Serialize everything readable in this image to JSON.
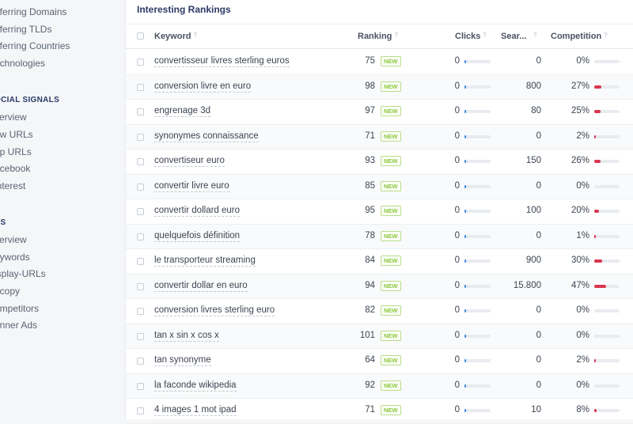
{
  "colors": {
    "clicks_bar": "#3b8be0",
    "competition_bar": "#d9364f",
    "new_badge": "#8cc63f",
    "heading": "#2b3a67"
  },
  "sidebar": {
    "items_top": [
      "eferring Domains",
      "eferring TLDs",
      "eferring Countries",
      "echnologies"
    ],
    "section_social": "OCIAL SIGNALS",
    "items_social": [
      "verview",
      "ew URLs",
      "op URLs",
      "acebook",
      "interest"
    ],
    "section_ads": "DS",
    "items_ads": [
      "verview",
      "eywords",
      "isplay-URLs",
      "dcopy",
      "ompetitors",
      "anner Ads"
    ]
  },
  "panel": {
    "title": "Interesting Rankings",
    "columns": {
      "keyword": "Keyword",
      "ranking": "Ranking",
      "clicks": "Clicks",
      "search": "Sear...",
      "competition": "Competition",
      "help_mark": "?"
    },
    "badge_label": "NEW",
    "rows": [
      {
        "keyword": "convertisseur livres sterling euros",
        "ranking": "75",
        "clicks": "0",
        "clicks_fraction": 0.03,
        "search": "0",
        "competition": "0%",
        "competition_fraction": 0.0
      },
      {
        "keyword": "conversion livre en euro",
        "ranking": "98",
        "clicks": "0",
        "clicks_fraction": 0.03,
        "search": "800",
        "competition": "27%",
        "competition_fraction": 0.27
      },
      {
        "keyword": "engrenage 3d",
        "ranking": "97",
        "clicks": "0",
        "clicks_fraction": 0.03,
        "search": "80",
        "competition": "25%",
        "competition_fraction": 0.25
      },
      {
        "keyword": "synonymes connaissance",
        "ranking": "71",
        "clicks": "0",
        "clicks_fraction": 0.03,
        "search": "0",
        "competition": "2%",
        "competition_fraction": 0.02
      },
      {
        "keyword": "convertiseur euro",
        "ranking": "93",
        "clicks": "0",
        "clicks_fraction": 0.03,
        "search": "150",
        "competition": "26%",
        "competition_fraction": 0.26
      },
      {
        "keyword": "convertir livre euro",
        "ranking": "85",
        "clicks": "0",
        "clicks_fraction": 0.03,
        "search": "0",
        "competition": "0%",
        "competition_fraction": 0.0
      },
      {
        "keyword": "convertir dollard euro",
        "ranking": "95",
        "clicks": "0",
        "clicks_fraction": 0.03,
        "search": "100",
        "competition": "20%",
        "competition_fraction": 0.2
      },
      {
        "keyword": "quelquefois définition",
        "ranking": "78",
        "clicks": "0",
        "clicks_fraction": 0.03,
        "search": "0",
        "competition": "1%",
        "competition_fraction": 0.01
      },
      {
        "keyword": "le transporteur streaming",
        "ranking": "84",
        "clicks": "0",
        "clicks_fraction": 0.03,
        "search": "900",
        "competition": "30%",
        "competition_fraction": 0.3
      },
      {
        "keyword": "convertir dollar en euro",
        "ranking": "94",
        "clicks": "0",
        "clicks_fraction": 0.03,
        "search": "15.800",
        "competition": "47%",
        "competition_fraction": 0.47
      },
      {
        "keyword": "conversion livres sterling euro",
        "ranking": "82",
        "clicks": "0",
        "clicks_fraction": 0.03,
        "search": "0",
        "competition": "0%",
        "competition_fraction": 0.0
      },
      {
        "keyword": "tan x sin x cos x",
        "ranking": "101",
        "clicks": "0",
        "clicks_fraction": 0.03,
        "search": "0",
        "competition": "0%",
        "competition_fraction": 0.0
      },
      {
        "keyword": "tan synonyme",
        "ranking": "64",
        "clicks": "0",
        "clicks_fraction": 0.03,
        "search": "0",
        "competition": "2%",
        "competition_fraction": 0.02
      },
      {
        "keyword": "la faconde wikipedia",
        "ranking": "92",
        "clicks": "0",
        "clicks_fraction": 0.03,
        "search": "0",
        "competition": "0%",
        "competition_fraction": 0.0
      },
      {
        "keyword": "4 images 1 mot ipad",
        "ranking": "71",
        "clicks": "0",
        "clicks_fraction": 0.03,
        "search": "10",
        "competition": "8%",
        "competition_fraction": 0.08
      }
    ]
  }
}
